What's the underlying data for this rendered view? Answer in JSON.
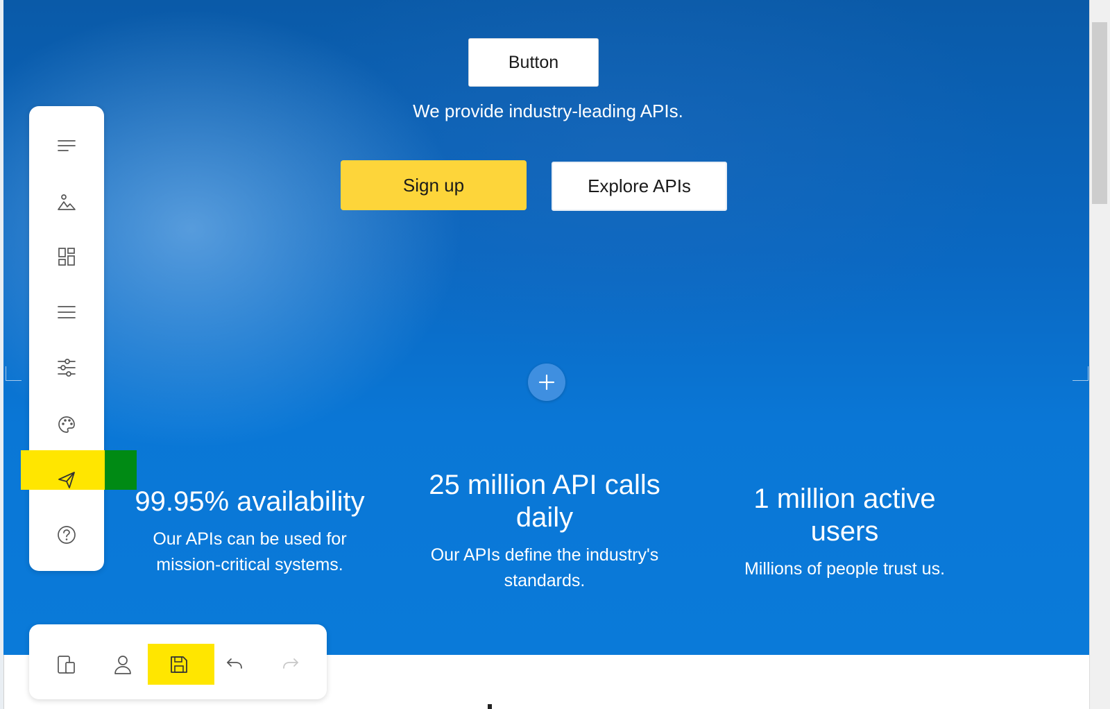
{
  "hero": {
    "button_label": "Button",
    "tagline": "We provide industry-leading APIs.",
    "signup_label": "Sign up",
    "explore_label": "Explore APIs"
  },
  "stats": [
    {
      "title": "99.95% availability",
      "desc": "Our APIs can be used for mission-critical systems."
    },
    {
      "title": "25 million API calls daily",
      "desc": "Our APIs define the industry's standards."
    },
    {
      "title": "1 million active users",
      "desc": "Millions of people trust us."
    }
  ],
  "sidebar": {
    "items": [
      "text-lines-icon",
      "image-icon",
      "layout-icon",
      "menu-icon",
      "sliders-icon",
      "palette-icon",
      "send-icon",
      "help-icon"
    ]
  },
  "toolbar": {
    "items": [
      "devices-icon",
      "user-icon",
      "save-icon",
      "undo-icon",
      "redo-icon"
    ]
  },
  "colors": {
    "accent_yellow": "#fdd53a",
    "highlight_yellow": "#ffe600",
    "highlight_green": "#008a14",
    "hero_blue": "#0a77d6"
  }
}
